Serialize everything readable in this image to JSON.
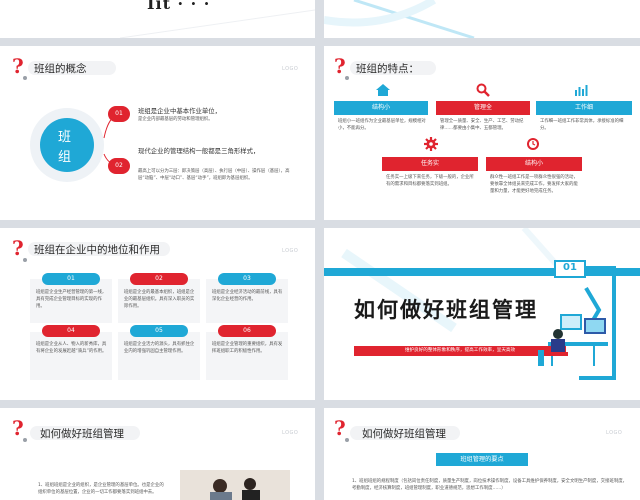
{
  "common": {
    "logo_text": "LOGO",
    "question_mark": "?"
  },
  "slide1": {
    "title_fragment": "Iit · · ·"
  },
  "slide3": {
    "title": "班组的概念",
    "circle_text": [
      "班",
      "组"
    ],
    "items": [
      {
        "num": "01",
        "heading": "班组是企业中基本作业单位，",
        "text": "是企业内部最基层的劳动和管理组织。"
      },
      {
        "num": "02",
        "heading": "现代企业的管理结构一般都是三角形样式，",
        "text": "最高上可以分为三层：即决策层（高层）、执行层（中层）、操作层（基层），高层“动脑”、中层“动口”、基层“动手”，班组即为基层组织。"
      }
    ]
  },
  "slide4": {
    "title": "班组的特点：",
    "top_cards": [
      {
        "icon": "home-icon",
        "label": "结构小",
        "text": "班组小一班组作为企业最基层单位，规模相对小，不能再分。"
      },
      {
        "icon": "search-icon",
        "label": "管理全",
        "text": "管理全一质量、安全、生产、工艺、劳动纪律……都要由小集中、五都管理。"
      },
      {
        "icon": "chart-icon",
        "label": "工作细",
        "text": "工作细一班组工作非常具体，承接标准的细分。"
      }
    ],
    "bottom_cards": [
      {
        "icon": "gear-icon",
        "label": "任务实",
        "text": "任务实一上级下来任务，下级一般的，企业所有的需求和目标都要落实到班组。"
      },
      {
        "icon": "clock-icon",
        "label": "结构小",
        "text": "群众性—班组工作是一项群众性很强的活动，要依靠全体组员来完成工作，要发挥大家的能量和力量，才能更好地完成任务。"
      }
    ]
  },
  "slide5": {
    "title": "班组在企业中的地位和作用",
    "cards": [
      {
        "num": "01",
        "text": "班组是企业生产经营管理的第一线，具有完成企业管理目标的实现的作用。"
      },
      {
        "num": "02",
        "text": "班组是企业的最基本组织，班组是企业的最基层组织。具有深入职员的实际作用。"
      },
      {
        "num": "03",
        "text": "班组是企业经济活动的最前线，具有深化企业经营的作用。"
      },
      {
        "num": "04",
        "text": "班组是企业从人、物入的新秀库，具有将企业的发展赶越“骑兵”的作用。"
      },
      {
        "num": "05",
        "text": "班组是企业活力的源头，具有抓住企业内的增强巩固自主管理作用。"
      },
      {
        "num": "06",
        "text": "班组是企业管理的重要组织，具有发挥班组职工的积极性作用。"
      }
    ]
  },
  "slide6": {
    "section_num": "01",
    "title": "如何做好班组管理",
    "subtitle": "维护良好的整体形象和秩序，提高工作效率，呈天高效"
  },
  "slide7": {
    "title": "如何做好班组管理",
    "item": "1、班组班组是企业的组织，是企业管理的基层单位。也是企业的组织单位的基层位置，企业的一切工作都要落实到班组中去。"
  },
  "slide8": {
    "title": "如何做好班组管理",
    "tag": "班组管理的要点",
    "text": "1、班组班组的规程制度（包括岗位责任制度，质量生产制度，岗位技术操作制度，设备工具维护保养制度，安全文明生产制度，交接班制度，考勤制度，经济核算制度，班组管理制度，职业道德规范，思想工作制度……）"
  },
  "colors": {
    "red": "#e0242f",
    "blue": "#1fa8d6",
    "dark": "#2b2b2b"
  }
}
